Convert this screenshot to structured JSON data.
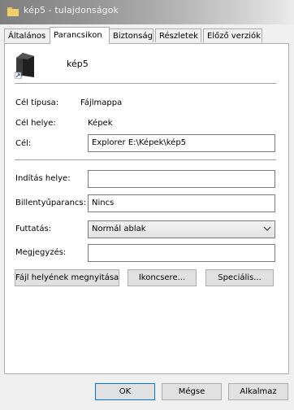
{
  "window": {
    "title": "kép5 - tulajdonságok"
  },
  "tabs": [
    {
      "label": "Általános"
    },
    {
      "label": "Parancsikon"
    },
    {
      "label": "Biztonság"
    },
    {
      "label": "Részletek"
    },
    {
      "label": "Előző verziók"
    }
  ],
  "active_tab": "Parancsikon",
  "shortcut": {
    "name": "kép5",
    "target_type_label": "Cél típusa:",
    "target_type_value": "Fájlmappa",
    "target_location_label": "Cél helye:",
    "target_location_value": "Képek",
    "target_label": "Cél:",
    "target_value": "Explorer E:\\Képek\\kép5",
    "start_in_label": "Indítás helye:",
    "start_in_value": "",
    "hotkey_label": "Billentyűparancs:",
    "hotkey_value": "Nincs",
    "run_label": "Futtatás:",
    "run_value": "Normál ablak",
    "comment_label": "Megjegyzés:",
    "comment_value": ""
  },
  "actions": {
    "open_location": "Fájl helyének megnyitása",
    "change_icon": "Ikoncsere...",
    "advanced": "Speciális..."
  },
  "footer": {
    "ok": "OK",
    "cancel": "Mégse",
    "apply": "Alkalmaz"
  },
  "icons": {
    "title_icon": "folder-icon",
    "shortcut_icon": "folder-icon",
    "run_dropdown": "chevron-down-icon"
  }
}
